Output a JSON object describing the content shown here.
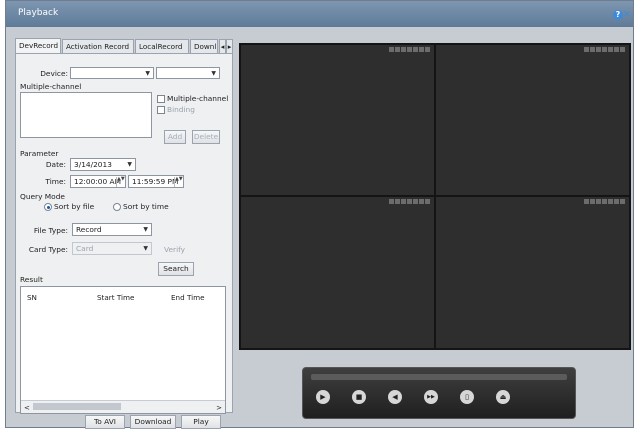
{
  "window": {
    "title": "Playback"
  },
  "tabs": [
    {
      "label": "DevRecord",
      "active": true
    },
    {
      "label": "Activation Record",
      "active": false
    },
    {
      "label": "LocalRecord",
      "active": false
    },
    {
      "label": "Downl",
      "active": false
    }
  ],
  "tab_scroll": {
    "left": "◂",
    "right": "▸"
  },
  "device": {
    "label": "Device:",
    "value1": "",
    "value2": ""
  },
  "multichannel": {
    "section_label": "Multiple-channel",
    "checkbox_label": "Multiple-channel",
    "binding_label": "Binding",
    "add_label": "Add",
    "delete_label": "Delete"
  },
  "parameter": {
    "section_label": "Parameter",
    "date_label": "Date:",
    "date_value": "3/14/2013",
    "time_label": "Time:",
    "time_start": "12:00:00 AM",
    "time_end": "11:59:59 PM"
  },
  "query_mode": {
    "label": "Query Mode",
    "by_file": "Sort by file",
    "by_time": "Sort by time",
    "selected": "by_file"
  },
  "file_type": {
    "label": "File Type:",
    "value": "Record"
  },
  "card_type": {
    "label": "Card Type:",
    "value": "Card",
    "verify_label": "Verify"
  },
  "search_label": "Search",
  "result": {
    "label": "Result",
    "columns": [
      "SN",
      "Start Time",
      "End Time"
    ],
    "scroll_left": "<",
    "scroll_right": ">"
  },
  "bottom_buttons": {
    "to_avi": "To AVI",
    "download": "Download",
    "play": "Play"
  },
  "controls": {
    "play": "▶",
    "stop": "■",
    "slow": "◀",
    "fast": "▶▶",
    "capture": "▯",
    "eject": "⏏"
  },
  "colors": {
    "titlebar": "#6d88a6",
    "video_bg": "#141414",
    "cell_bg": "#2e2e2e",
    "accent": "#3d8ad8"
  }
}
